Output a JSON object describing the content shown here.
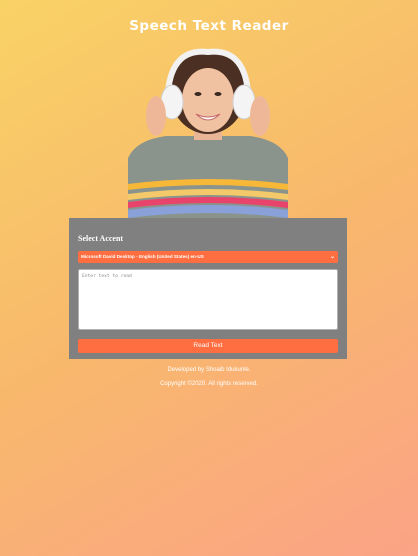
{
  "app": {
    "title": "Speech Text Reader"
  },
  "hero": {
    "icon": "woman-with-headphones-illustration"
  },
  "form": {
    "accent_label": "Select Accent",
    "voice_selected": "Microsoft David Desktop - English (United States) en-US",
    "text_placeholder": "Enter text to read",
    "read_button_label": "Read Text"
  },
  "footer": {
    "developer": "Developed by Shoaib Idukunle.",
    "copyright": "Copyright ©2020. All rights reserved."
  },
  "colors": {
    "accent": "#ff6e40",
    "panel": "#808080"
  }
}
